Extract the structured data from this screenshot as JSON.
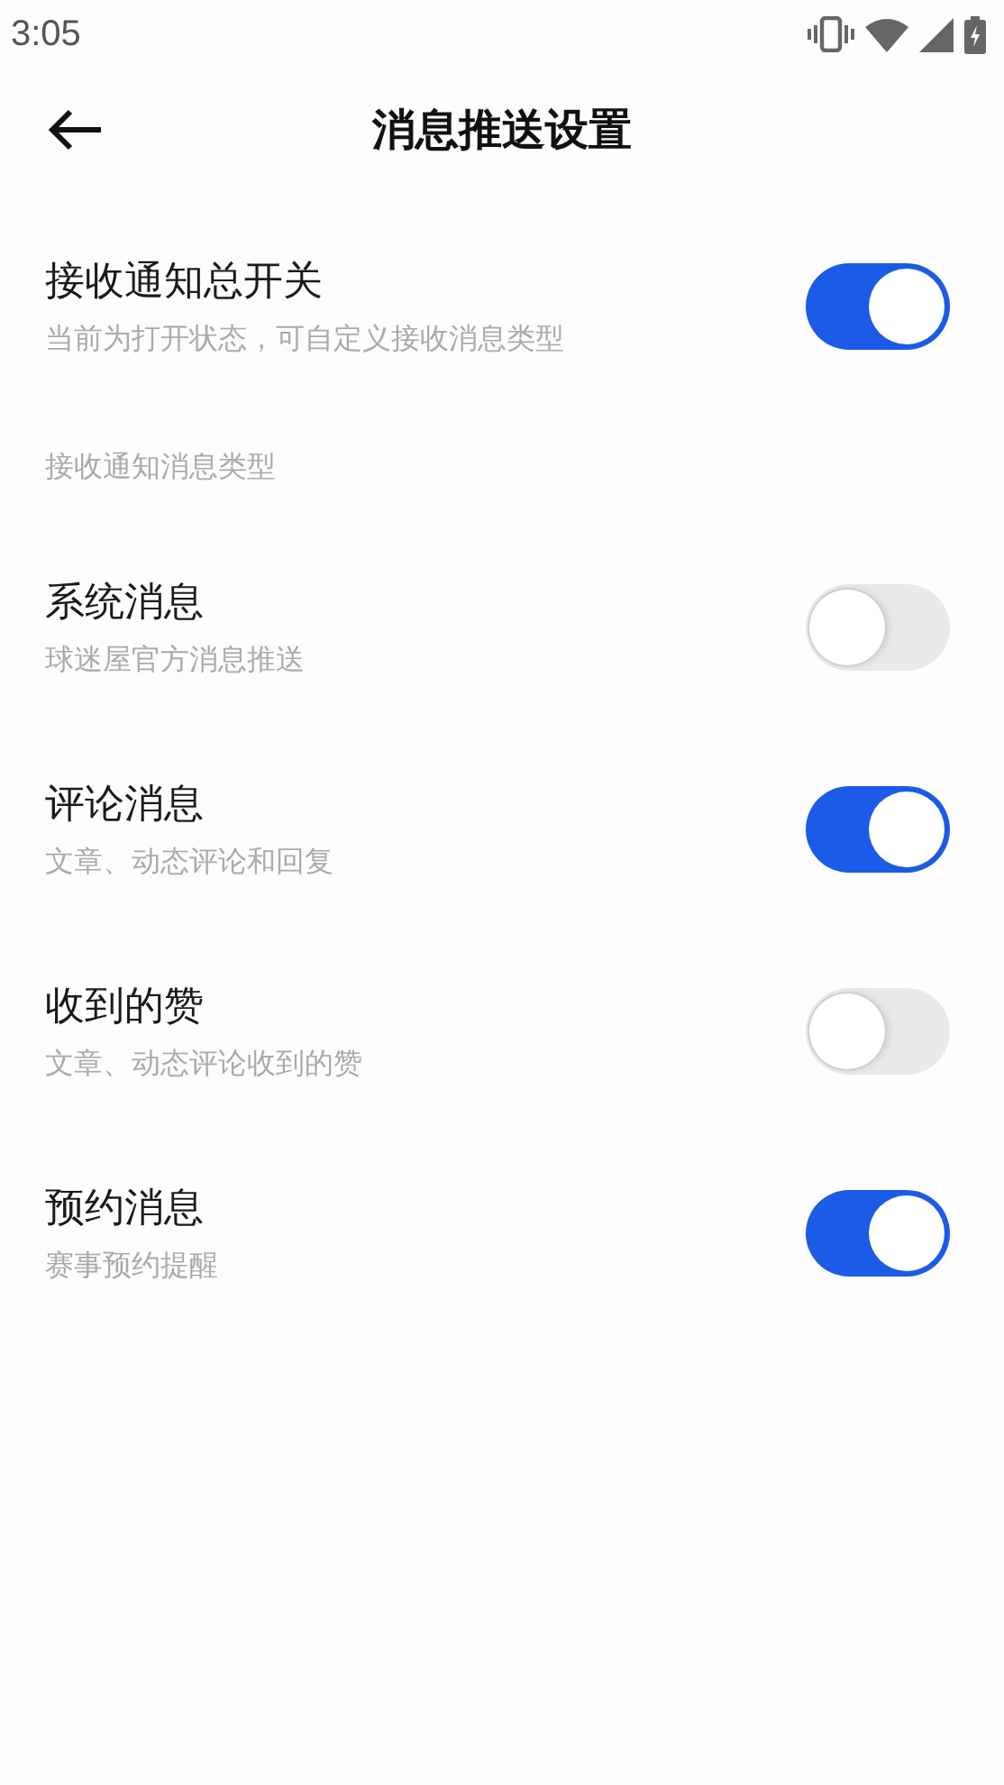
{
  "status_bar": {
    "time": "3:05"
  },
  "header": {
    "title": "消息推送设置"
  },
  "master": {
    "title": "接收通知总开关",
    "subtitle": "当前为打开状态，可自定义接收消息类型",
    "on": true
  },
  "section_label": "接收通知消息类型",
  "items": [
    {
      "title": "系统消息",
      "subtitle": "球迷屋官方消息推送",
      "on": false
    },
    {
      "title": "评论消息",
      "subtitle": "文章、动态评论和回复",
      "on": true
    },
    {
      "title": "收到的赞",
      "subtitle": "文章、动态评论收到的赞",
      "on": false
    },
    {
      "title": "预约消息",
      "subtitle": "赛事预约提醒",
      "on": true
    }
  ]
}
